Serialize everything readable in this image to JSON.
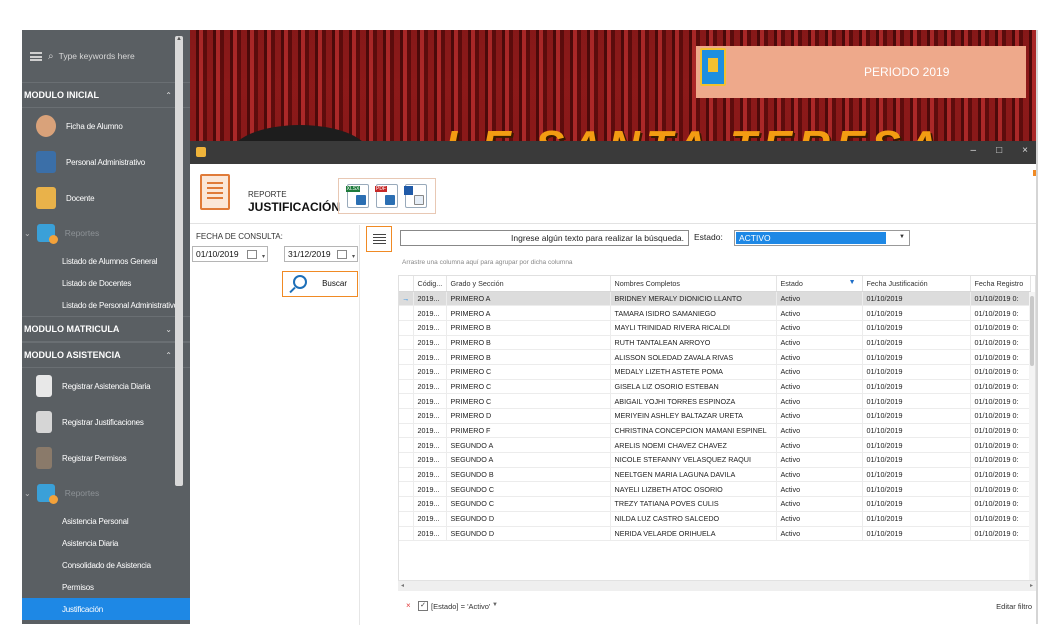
{
  "sidebar": {
    "search_placeholder": "Type keywords here",
    "modules": {
      "inicial": "MODULO INICIAL",
      "matricula": "MODULO MATRICULA",
      "asistencia": "MODULO ASISTENCIA"
    },
    "inicial_items": [
      "Ficha de Alumno",
      "Personal Administrativo",
      "Docente"
    ],
    "inicial_reportes_label": "Reportes",
    "inicial_reportes": [
      "Listado de Alumnos General",
      "Listado de Docentes",
      "Listado de Personal Administrativo"
    ],
    "asistencia_items": [
      "Registrar Asistencia Diaria",
      "Registrar Justificaciones",
      "Registrar Permisos"
    ],
    "asistencia_reportes_label": "Reportes",
    "asistencia_reportes": [
      "Asistencia Personal",
      "Asistencia Diaria",
      "Consolidado de Asistencia",
      "Permisos",
      "Justificación"
    ],
    "active_item": "Justificación"
  },
  "banner": {
    "periodo": "PERIODO 2019",
    "school_text": "I.E SANTA TERESA"
  },
  "window": {
    "controls": [
      "–",
      "□",
      "×"
    ]
  },
  "toolbar": {
    "report_small": "REPORTE",
    "report_title": "JUSTIFICACIÓN",
    "exports": [
      {
        "name": "excel-export-icon",
        "tag": "XLSX",
        "color": "#1e7b3c"
      },
      {
        "name": "pdf-export-icon",
        "tag": "PDF",
        "color": "#c62828"
      },
      {
        "name": "word-export-icon",
        "tag": "",
        "color": "#1f5aa8"
      }
    ]
  },
  "filters": {
    "fecha_label": "FECHA DE CONSULTA:",
    "date_from": "01/10/2019",
    "date_to": "31/12/2019",
    "buscar_label": "Buscar"
  },
  "grid": {
    "search_placeholder": "Ingrese algún texto para realizar la búsqueda.",
    "estado_label": "Estado:",
    "estado_value": "ACTIVO",
    "group_hint": "Arrastre una columna aquí para agrupar por dicha columna",
    "columns": [
      "Códig...",
      "Grado y Sección",
      "Nombres Completos",
      "Estado",
      "Fecha Justificación",
      "Fecha Registro"
    ],
    "rows": [
      [
        "2019...",
        "PRIMERO A",
        "BRIDNEY MERALY DIONICIO LLANTO",
        "Activo",
        "01/10/2019",
        "01/10/2019 0:"
      ],
      [
        "2019...",
        "PRIMERO A",
        "TAMARA  ISIDRO SAMANIEGO",
        "Activo",
        "01/10/2019",
        "01/10/2019 0:"
      ],
      [
        "2019...",
        "PRIMERO B",
        "MAYLI TRINIDAD RIVERA RICALDI",
        "Activo",
        "01/10/2019",
        "01/10/2019 0:"
      ],
      [
        "2019...",
        "PRIMERO B",
        "RUTH  TANTALEAN ARROYO",
        "Activo",
        "01/10/2019",
        "01/10/2019 0:"
      ],
      [
        "2019...",
        "PRIMERO B",
        "ALISSON SOLEDAD ZAVALA RIVAS",
        "Activo",
        "01/10/2019",
        "01/10/2019 0:"
      ],
      [
        "2019...",
        "PRIMERO C",
        "MEDALY LIZETH ASTETE POMA",
        "Activo",
        "01/10/2019",
        "01/10/2019 0:"
      ],
      [
        "2019...",
        "PRIMERO C",
        "GISELA LIZ OSORIO ESTEBAN",
        "Activo",
        "01/10/2019",
        "01/10/2019 0:"
      ],
      [
        "2019...",
        "PRIMERO C",
        "ABIGAIL YOJHI TORRES ESPINOZA",
        "Activo",
        "01/10/2019",
        "01/10/2019 0:"
      ],
      [
        "2019...",
        "PRIMERO D",
        "MERIYEIN ASHLEY BALTAZAR URETA",
        "Activo",
        "01/10/2019",
        "01/10/2019 0:"
      ],
      [
        "2019...",
        "PRIMERO F",
        "CHRISTINA CONCEPCION MAMANI ESPINEL",
        "Activo",
        "01/10/2019",
        "01/10/2019 0:"
      ],
      [
        "2019...",
        "SEGUNDO A",
        "ARELIS NOEMI CHAVEZ CHAVEZ",
        "Activo",
        "01/10/2019",
        "01/10/2019 0:"
      ],
      [
        "2019...",
        "SEGUNDO A",
        "NICOLE STEFANNY VELASQUEZ RAQUI",
        "Activo",
        "01/10/2019",
        "01/10/2019 0:"
      ],
      [
        "2019...",
        "SEGUNDO B",
        "NEELTGEN MARIA LAGUNA DAVILA",
        "Activo",
        "01/10/2019",
        "01/10/2019 0:"
      ],
      [
        "2019...",
        "SEGUNDO C",
        "NAYELI LIZBETH ATOC OSORIO",
        "Activo",
        "01/10/2019",
        "01/10/2019 0:"
      ],
      [
        "2019...",
        "SEGUNDO C",
        "TREZY TATIANA POVES CULIS",
        "Activo",
        "01/10/2019",
        "01/10/2019 0:"
      ],
      [
        "2019...",
        "SEGUNDO D",
        "NILDA LUZ CASTRO SALCEDO",
        "Activo",
        "01/10/2019",
        "01/10/2019 0:"
      ],
      [
        "2019...",
        "SEGUNDO D",
        "NERIDA  VELARDE ORIHUELA",
        "Activo",
        "01/10/2019",
        "01/10/2019 0:"
      ]
    ],
    "filter_text": "[Estado] = 'Activo'",
    "edit_filter": "Editar filtro"
  }
}
